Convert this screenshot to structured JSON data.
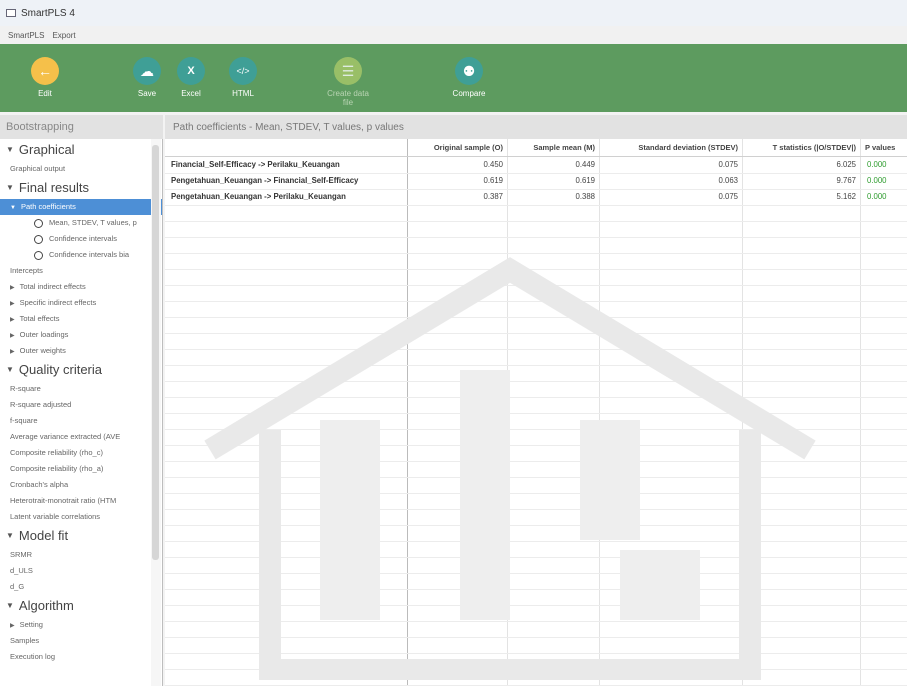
{
  "window": {
    "title": "SmartPLS 4"
  },
  "menu": [
    "SmartPLS",
    "Export"
  ],
  "toolbar": {
    "edit": "Edit",
    "save": "Save",
    "excel": "Excel",
    "html": "HTML",
    "create_data_file": "Create data file",
    "compare": "Compare"
  },
  "sidebar": {
    "header": "Bootstrapping",
    "sections": [
      {
        "title": "Graphical",
        "items": [
          "Graphical output"
        ]
      },
      {
        "title": "Final results"
      },
      {
        "title": "Quality criteria"
      },
      {
        "title": "Model fit"
      },
      {
        "title": "Algorithm"
      }
    ],
    "path_coefficients": "Path coefficients",
    "radio_options": [
      "Mean, STDEV, T values, p",
      "Confidence intervals",
      "Confidence intervals bia"
    ],
    "final_items": [
      "Intercepts",
      "Total indirect effects",
      "Specific indirect effects",
      "Total effects",
      "Outer loadings",
      "Outer weights"
    ],
    "quality_items": [
      "R-square",
      "R-square adjusted",
      "f-square",
      "Average variance extracted (AVE",
      "Composite reliability (rho_c)",
      "Composite reliability (rho_a)",
      "Cronbach's alpha",
      "Heterotrait-monotrait ratio (HTM",
      "Latent variable correlations"
    ],
    "fit_items": [
      "SRMR",
      "d_ULS",
      "d_G"
    ],
    "algorithm_items": [
      "Setting",
      "Samples",
      "Execution log"
    ]
  },
  "content": {
    "title": "Path coefficients - Mean, STDEV, T values, p values",
    "columns": [
      "",
      "Original sample (O)",
      "Sample mean (M)",
      "Standard deviation (STDEV)",
      "T statistics (|O/STDEV|)",
      "P values"
    ],
    "rows": [
      {
        "label": "Financial_Self-Efficacy -> Perilaku_Keuangan",
        "o": "0.450",
        "m": "0.449",
        "stdev": "0.075",
        "t": "6.025",
        "p": "0.000"
      },
      {
        "label": "Pengetahuan_Keuangan -> Financial_Self-Efficacy",
        "o": "0.619",
        "m": "0.619",
        "stdev": "0.063",
        "t": "9.767",
        "p": "0.000"
      },
      {
        "label": "Pengetahuan_Keuangan -> Perilaku_Keuangan",
        "o": "0.387",
        "m": "0.388",
        "stdev": "0.075",
        "t": "5.162",
        "p": "0.000"
      }
    ]
  },
  "colors": {
    "toolbar": "#5d9b5f",
    "selection": "#4d8fd6",
    "pvalue": "#2e9c2e"
  }
}
